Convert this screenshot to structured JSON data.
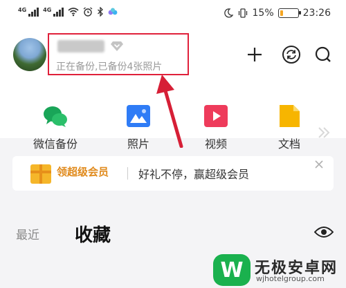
{
  "status_bar": {
    "signal_1_label": "4G",
    "signal_2_label": "4G",
    "battery_percent": "15%",
    "battery_level": 0.15,
    "battery_color": "#f5a623",
    "time": "23:26",
    "icons": [
      "wifi-icon",
      "alarm-icon",
      "bluetooth-icon",
      "app-indicator-icon",
      "moon-icon",
      "vibrate-icon",
      "battery-icon"
    ]
  },
  "profile": {
    "username": "",
    "backup_status": "正在备份,已备份4张照片",
    "highlight_color": "#e0203a"
  },
  "header_actions": [
    "add-icon",
    "sync-icon",
    "search-icon"
  ],
  "quick_tiles": [
    {
      "label": "微信备份",
      "icon": "wechat-icon",
      "color": "#19a558"
    },
    {
      "label": "照片",
      "icon": "photo-icon",
      "color": "#2f7cf6"
    },
    {
      "label": "视频",
      "icon": "video-icon",
      "color": "#ee3b5b"
    },
    {
      "label": "文档",
      "icon": "document-icon",
      "color": "#f7b500"
    }
  ],
  "promo": {
    "tag": "领超级会员",
    "text": "好礼不停，赢超级会员"
  },
  "tabs": {
    "recent": "最近",
    "favorites": "收藏"
  },
  "watermark": {
    "title": "无极安卓网",
    "url": "wjhotelgroup.com",
    "logo_letter": "W"
  }
}
